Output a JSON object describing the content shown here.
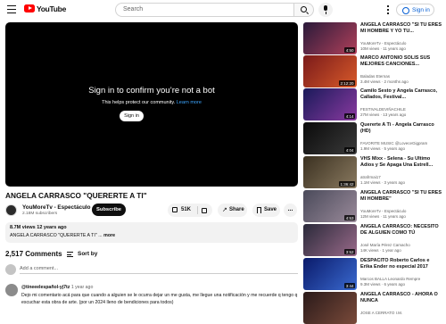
{
  "header": {
    "logo_text": "YouTube",
    "search_placeholder": "Search",
    "signin_label": "Sign in"
  },
  "player": {
    "title": "Sign in to confirm you’re not a bot",
    "subtitle": "This helps protect our community.",
    "learn_more": "Learn more",
    "signin_label": "Sign in"
  },
  "video": {
    "title": "ANGELA CARRASCO \"QUERERTE A TI\"",
    "channel_name": "YouMoreTv - Espectáculo",
    "subscribers": "2.18M subscribers",
    "subscribe_label": "Subscribe",
    "likes": "51K",
    "share_label": "Share",
    "save_label": "Save",
    "more_label": "...",
    "views_date": "8.7M views  12 years ago",
    "description": "ANGELA CARRASCO \"QUERERTE A TI\" ...",
    "description_more": "more"
  },
  "comments": {
    "count_label": "2,517 Comments",
    "sort_label": "Sort by",
    "add_placeholder": "Add a comment...",
    "first": {
      "author": "@tineeelespañol-yj7tz",
      "time": "1 year ago",
      "text": "Dejo mi comentario acá para que cuando a alguien se le ocurra dejar un me gusta, me llegue una notificación y me recuerde q tengo q escuchar esta obra de arte. (por un 2024 lleno de bendiciones para todos)"
    }
  },
  "sidebar": [
    {
      "title": "ANGELA CARRASCO \"SI TÚ ERES MI HOMBRE Y YO TU...",
      "channel": "YouMoreTv - Espectáculo",
      "meta": "10M views · 11 years ago",
      "duration": "4:50",
      "color_a": "#2a1a3a",
      "color_b": "#b0405a"
    },
    {
      "title": "MARCO ANTONIO SOLIS SUS MEJORES CANCIONES...",
      "channel": "Baladas Eternas",
      "meta": "3.4M views · 2 months ago",
      "duration": "2:12:20",
      "color_a": "#7a1a1a",
      "color_b": "#d85a2a"
    },
    {
      "title": "Camilo Sesto y Angela Carrasco, Callados, Festival...",
      "channel": "FESTIVALDEVIÑACHILE",
      "meta": "27M views · 13 years ago",
      "duration": "4:14",
      "color_a": "#1a1a5a",
      "color_b": "#8a3aa0"
    },
    {
      "title": "Quererte A Ti - Angela Carrasco (HD)",
      "channel": "FAVORITE MUSIC @LoveceGigpram",
      "meta": "1.9M views · 5 years ago",
      "duration": "4:04",
      "color_a": "#0a0a0a",
      "color_b": "#3a3a3a"
    },
    {
      "title": "VHS Mixx - Selena - Su Ultimo Adios y Se Apaga Una Estrell...",
      "channel": "atrafrmai17",
      "meta": "1.1M views · 3 years ago",
      "duration": "1:36:42",
      "color_a": "#3a3020",
      "color_b": "#8a7a60"
    },
    {
      "title": "ANGELA CARRASCO \"SI TÚ ERES MI HOMBRE\"",
      "channel": "YouMoreTv - Espectáculo",
      "meta": "12M views · 11 years ago",
      "duration": "4:53",
      "color_a": "#4a4a5a",
      "color_b": "#9a8a9a"
    },
    {
      "title": "ANGELA CARRASCO: NECESITO DE ALGUIEN COMO TÚ",
      "channel": "José María Pérez Camacho",
      "meta": "14K views · 1 year ago",
      "duration": "3:52",
      "color_a": "#2a2a3a",
      "color_b": "#9a6a8a"
    },
    {
      "title": "DESPACITO Roberto Carlos e Erika Ender no especial 2017",
      "channel": "Marcos BALLA Leonardo Rempre",
      "meta": "9.3M views · 6 years ago",
      "duration": "3:44",
      "color_a": "#0a1a6a",
      "color_b": "#3a6ad0"
    },
    {
      "title": "ANGELA CARRASCO - AHORA O NUNCA",
      "channel": "JOSE A CERRATO I.M.",
      "meta": "",
      "duration": "",
      "color_a": "#2a1a1a",
      "color_b": "#7a4a3a"
    }
  ]
}
